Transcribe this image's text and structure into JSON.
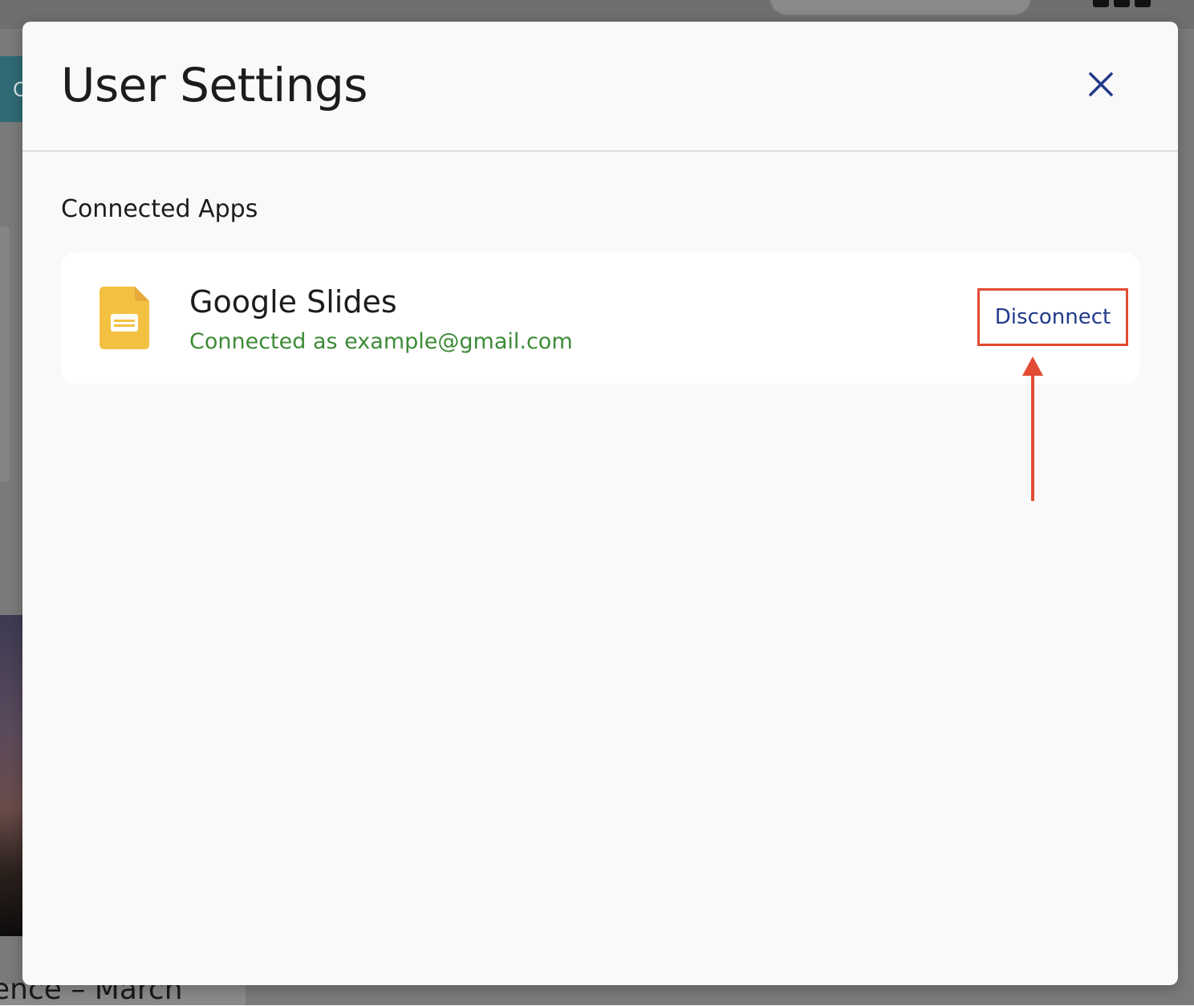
{
  "modal": {
    "title": "User Settings",
    "close_icon": "close-icon"
  },
  "connected_apps": {
    "heading": "Connected Apps",
    "apps": [
      {
        "name": "Google Slides",
        "icon": "google-slides-icon",
        "status": "Connected as example@gmail.com",
        "action_label": "Disconnect"
      }
    ]
  },
  "background": {
    "teal_tab_letter": "C",
    "caption_fragment": "ence – March"
  },
  "colors": {
    "accent_text": "#233a8a",
    "connected_status": "#3d8b37",
    "annotation": "#e24a33",
    "slides_icon": "#f4c042"
  }
}
